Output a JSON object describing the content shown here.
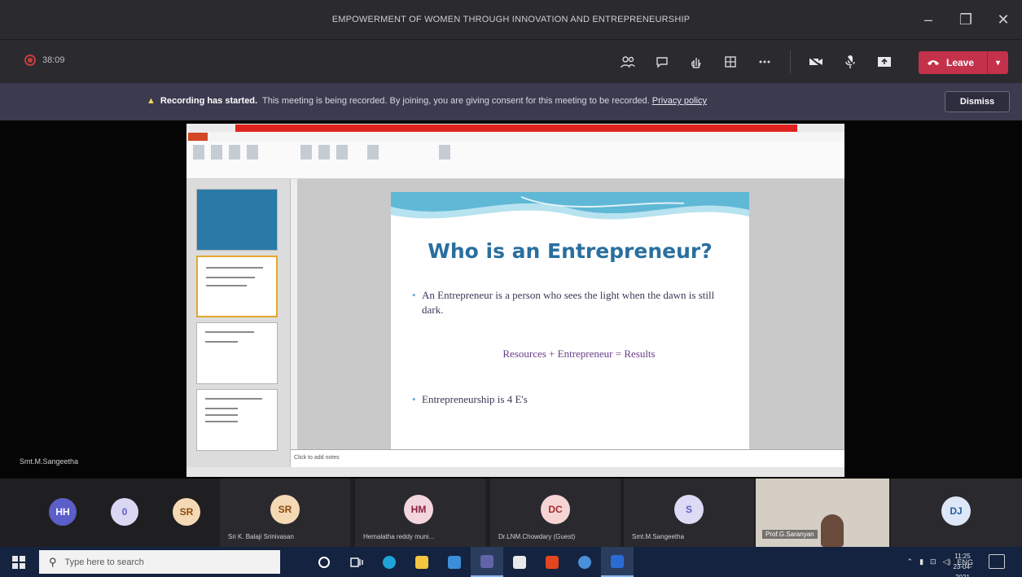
{
  "window": {
    "title": "EMPOWERMENT OF WOMEN THROUGH INNOVATION AND ENTREPRENEURSHIP",
    "controls": {
      "minimize": "–",
      "maximize": "❐",
      "close": "✕"
    }
  },
  "toolbar": {
    "recording_time": "38:09",
    "icons": [
      "participants-icon",
      "chat-icon",
      "raise-hand-icon",
      "rooms-icon",
      "more-icon",
      "camera-icon",
      "mic-icon",
      "share-icon"
    ],
    "leave_label": "Leave",
    "leave_color": "#c4314b"
  },
  "banner": {
    "title": "Recording has started.",
    "message": "This meeting is being recorded. By joining, you are giving consent for this meeting to be recorded.",
    "link": "Privacy policy",
    "dismiss_label": "Dismiss"
  },
  "stage": {
    "presenter_name": "Smt.M.Sangeetha"
  },
  "slide": {
    "title": "Who is an Entrepreneur?",
    "bullet1": "An Entrepreneur is a person who sees the light when the dawn is still dark.",
    "formula": "Resources + Entrepreneur = Results",
    "bullet2": "Entrepreneurship is 4 E's",
    "notes_placeholder": "Click to add notes",
    "title_color": "#2a6f9e"
  },
  "participants": [
    {
      "initials": "HH",
      "name": "",
      "bg": "#5b5fc7",
      "fg": "#ffffff"
    },
    {
      "initials": "0",
      "name": "",
      "bg": "#d9d7f2",
      "fg": "#5b5fc7"
    },
    {
      "initials": "SR",
      "name": "",
      "bg": "#f5d9b5",
      "fg": "#8a4b10"
    },
    {
      "initials": "SR",
      "name": "Sri K. Balaji Srinivasan",
      "bg": "#f5d9b5",
      "fg": "#8a4b10"
    },
    {
      "initials": "HM",
      "name": "Hemalatha reddy muni...",
      "bg": "#f3d5dd",
      "fg": "#8a2040"
    },
    {
      "initials": "DC",
      "name": "Dr.LNM.Chowdary (Guest)",
      "bg": "#f7d4d4",
      "fg": "#a42b2b"
    },
    {
      "initials": "S",
      "name": "Smt.M.Sangeetha",
      "bg": "#dcdaf5",
      "fg": "#5b5fc7"
    },
    {
      "initials": "",
      "name": "Prof.G.Saranyan",
      "bg": "",
      "fg": ""
    },
    {
      "initials": "DJ",
      "name": "",
      "bg": "#dde7f7",
      "fg": "#2a5c9e"
    }
  ],
  "taskbar": {
    "search_placeholder": "Type here to search",
    "time": "11:25",
    "date": "23-04-2021",
    "lang": "ENG"
  }
}
